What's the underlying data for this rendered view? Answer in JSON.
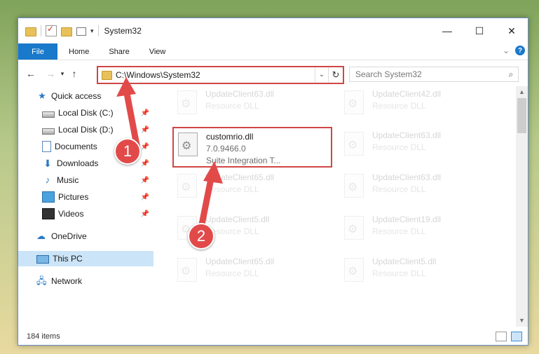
{
  "window": {
    "title": "System32",
    "controls": {
      "minimize": "—",
      "maximize": "☐",
      "close": "✕"
    }
  },
  "ribbon": {
    "file": "File",
    "tabs": [
      "Home",
      "Share",
      "View"
    ]
  },
  "address": {
    "path": "C:\\Windows\\System32",
    "search_placeholder": "Search System32"
  },
  "nav": {
    "quick_access": "Quick access",
    "items": [
      {
        "label": "Local Disk (C:)",
        "icon": "drive-icon"
      },
      {
        "label": "Local Disk (D:)",
        "icon": "drive-icon"
      },
      {
        "label": "Documents",
        "icon": "documents-icon"
      },
      {
        "label": "Downloads",
        "icon": "downloads-icon"
      },
      {
        "label": "Music",
        "icon": "music-icon"
      },
      {
        "label": "Pictures",
        "icon": "pictures-icon"
      },
      {
        "label": "Videos",
        "icon": "videos-icon"
      }
    ],
    "onedrive": "OneDrive",
    "this_pc": "This PC",
    "network": "Network"
  },
  "files": {
    "highlighted": {
      "name": "customrio.dll",
      "version": "7.0.9466.0",
      "description": "Suite Integration T..."
    },
    "background": [
      {
        "name": "UpdateClient63.dll",
        "type": "Resource DLL"
      },
      {
        "name": "UpdateClient42.dll",
        "type": "Resource DLL"
      },
      {
        "name": "UpdateClient63.dll",
        "type": "Resource DLL"
      },
      {
        "name": "UpdateClient65.dll",
        "type": "Resource DLL"
      },
      {
        "name": "UpdateClient63.dll",
        "type": "Resource DLL"
      },
      {
        "name": "UpdateClient5.dll",
        "type": "Resource DLL"
      },
      {
        "name": "UpdateClient19.dll",
        "type": "Resource DLL"
      },
      {
        "name": "UpdateClient65.dll",
        "type": "Resource DLL"
      },
      {
        "name": "UpdateClient5.dll",
        "type": "Resource DLL"
      }
    ]
  },
  "status": {
    "count": "184 items"
  },
  "annotations": {
    "step1": "1",
    "step2": "2"
  },
  "colors": {
    "accent": "#1979ca",
    "highlight": "#d04646",
    "selected": "#cce4f7"
  }
}
